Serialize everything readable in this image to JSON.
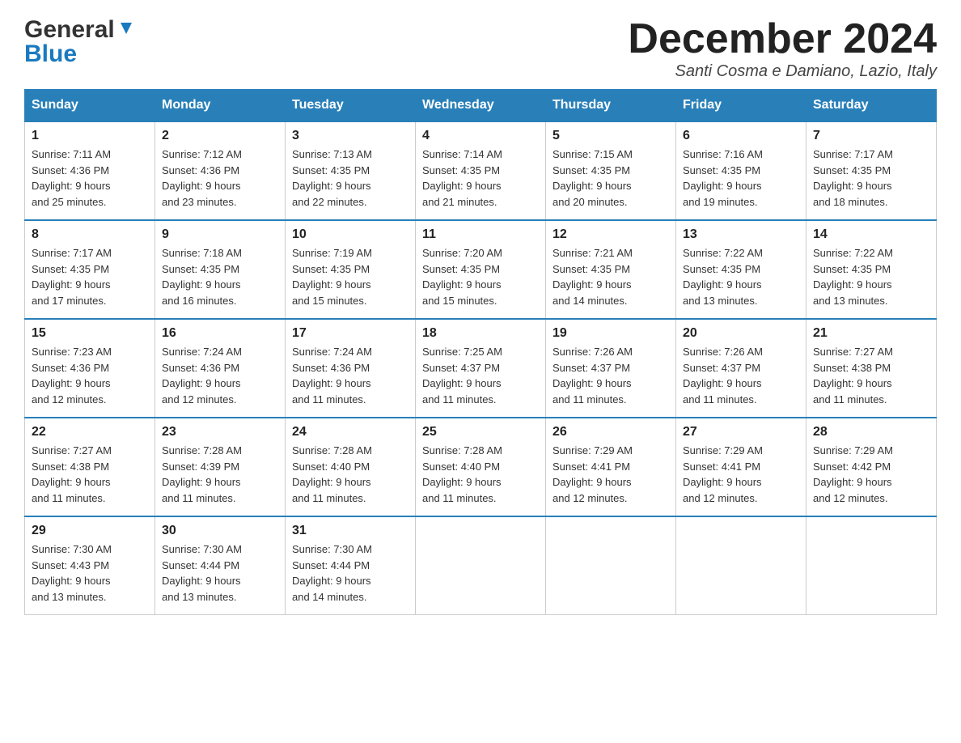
{
  "header": {
    "logo_general": "General",
    "logo_blue": "Blue",
    "title": "December 2024",
    "subtitle": "Santi Cosma e Damiano, Lazio, Italy"
  },
  "days_of_week": [
    "Sunday",
    "Monday",
    "Tuesday",
    "Wednesday",
    "Thursday",
    "Friday",
    "Saturday"
  ],
  "weeks": [
    [
      {
        "day": "1",
        "sunrise": "7:11 AM",
        "sunset": "4:36 PM",
        "daylight": "9 hours and 25 minutes."
      },
      {
        "day": "2",
        "sunrise": "7:12 AM",
        "sunset": "4:36 PM",
        "daylight": "9 hours and 23 minutes."
      },
      {
        "day": "3",
        "sunrise": "7:13 AM",
        "sunset": "4:35 PM",
        "daylight": "9 hours and 22 minutes."
      },
      {
        "day": "4",
        "sunrise": "7:14 AM",
        "sunset": "4:35 PM",
        "daylight": "9 hours and 21 minutes."
      },
      {
        "day": "5",
        "sunrise": "7:15 AM",
        "sunset": "4:35 PM",
        "daylight": "9 hours and 20 minutes."
      },
      {
        "day": "6",
        "sunrise": "7:16 AM",
        "sunset": "4:35 PM",
        "daylight": "9 hours and 19 minutes."
      },
      {
        "day": "7",
        "sunrise": "7:17 AM",
        "sunset": "4:35 PM",
        "daylight": "9 hours and 18 minutes."
      }
    ],
    [
      {
        "day": "8",
        "sunrise": "7:17 AM",
        "sunset": "4:35 PM",
        "daylight": "9 hours and 17 minutes."
      },
      {
        "day": "9",
        "sunrise": "7:18 AM",
        "sunset": "4:35 PM",
        "daylight": "9 hours and 16 minutes."
      },
      {
        "day": "10",
        "sunrise": "7:19 AM",
        "sunset": "4:35 PM",
        "daylight": "9 hours and 15 minutes."
      },
      {
        "day": "11",
        "sunrise": "7:20 AM",
        "sunset": "4:35 PM",
        "daylight": "9 hours and 15 minutes."
      },
      {
        "day": "12",
        "sunrise": "7:21 AM",
        "sunset": "4:35 PM",
        "daylight": "9 hours and 14 minutes."
      },
      {
        "day": "13",
        "sunrise": "7:22 AM",
        "sunset": "4:35 PM",
        "daylight": "9 hours and 13 minutes."
      },
      {
        "day": "14",
        "sunrise": "7:22 AM",
        "sunset": "4:35 PM",
        "daylight": "9 hours and 13 minutes."
      }
    ],
    [
      {
        "day": "15",
        "sunrise": "7:23 AM",
        "sunset": "4:36 PM",
        "daylight": "9 hours and 12 minutes."
      },
      {
        "day": "16",
        "sunrise": "7:24 AM",
        "sunset": "4:36 PM",
        "daylight": "9 hours and 12 minutes."
      },
      {
        "day": "17",
        "sunrise": "7:24 AM",
        "sunset": "4:36 PM",
        "daylight": "9 hours and 11 minutes."
      },
      {
        "day": "18",
        "sunrise": "7:25 AM",
        "sunset": "4:37 PM",
        "daylight": "9 hours and 11 minutes."
      },
      {
        "day": "19",
        "sunrise": "7:26 AM",
        "sunset": "4:37 PM",
        "daylight": "9 hours and 11 minutes."
      },
      {
        "day": "20",
        "sunrise": "7:26 AM",
        "sunset": "4:37 PM",
        "daylight": "9 hours and 11 minutes."
      },
      {
        "day": "21",
        "sunrise": "7:27 AM",
        "sunset": "4:38 PM",
        "daylight": "9 hours and 11 minutes."
      }
    ],
    [
      {
        "day": "22",
        "sunrise": "7:27 AM",
        "sunset": "4:38 PM",
        "daylight": "9 hours and 11 minutes."
      },
      {
        "day": "23",
        "sunrise": "7:28 AM",
        "sunset": "4:39 PM",
        "daylight": "9 hours and 11 minutes."
      },
      {
        "day": "24",
        "sunrise": "7:28 AM",
        "sunset": "4:40 PM",
        "daylight": "9 hours and 11 minutes."
      },
      {
        "day": "25",
        "sunrise": "7:28 AM",
        "sunset": "4:40 PM",
        "daylight": "9 hours and 11 minutes."
      },
      {
        "day": "26",
        "sunrise": "7:29 AM",
        "sunset": "4:41 PM",
        "daylight": "9 hours and 12 minutes."
      },
      {
        "day": "27",
        "sunrise": "7:29 AM",
        "sunset": "4:41 PM",
        "daylight": "9 hours and 12 minutes."
      },
      {
        "day": "28",
        "sunrise": "7:29 AM",
        "sunset": "4:42 PM",
        "daylight": "9 hours and 12 minutes."
      }
    ],
    [
      {
        "day": "29",
        "sunrise": "7:30 AM",
        "sunset": "4:43 PM",
        "daylight": "9 hours and 13 minutes."
      },
      {
        "day": "30",
        "sunrise": "7:30 AM",
        "sunset": "4:44 PM",
        "daylight": "9 hours and 13 minutes."
      },
      {
        "day": "31",
        "sunrise": "7:30 AM",
        "sunset": "4:44 PM",
        "daylight": "9 hours and 14 minutes."
      },
      null,
      null,
      null,
      null
    ]
  ],
  "labels": {
    "sunrise": "Sunrise:",
    "sunset": "Sunset:",
    "daylight": "Daylight:"
  },
  "colors": {
    "header_bg": "#2980b9",
    "header_text": "#ffffff",
    "border_top": "#2980b9",
    "logo_blue": "#1a7abf"
  }
}
